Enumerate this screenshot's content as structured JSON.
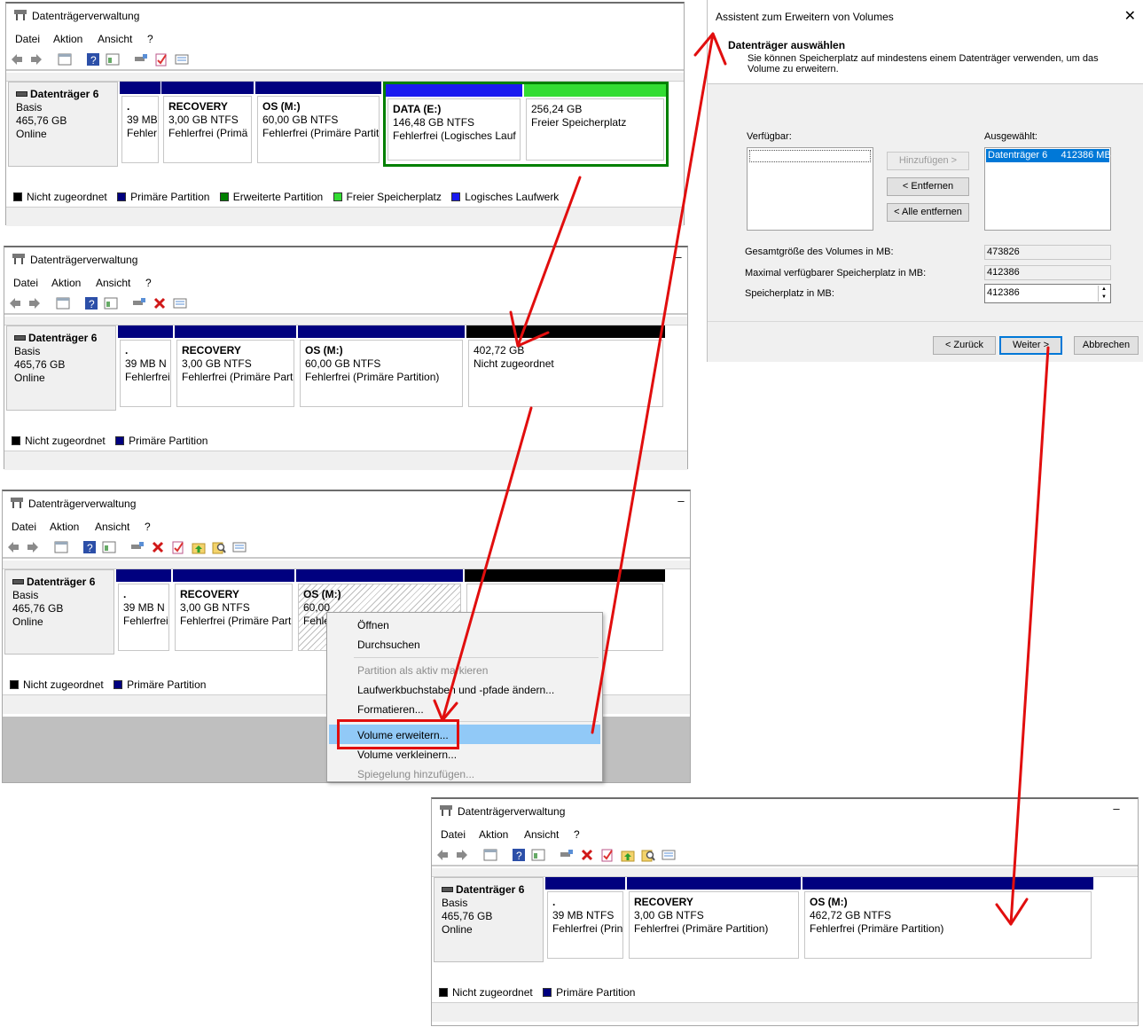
{
  "app_title": "Datenträgerverwaltung",
  "menu": {
    "file": "Datei",
    "action": "Aktion",
    "view": "Ansicht",
    "help": "?"
  },
  "disk": {
    "name": "Datenträger 6",
    "type": "Basis",
    "size": "465,76 GB",
    "status": "Online"
  },
  "panel1": {
    "partitions": [
      {
        "name": ".",
        "size": "39 MB",
        "status": "Fehler"
      },
      {
        "name": "RECOVERY",
        "size": "3,00 GB NTFS",
        "status": "Fehlerfrei (Primä"
      },
      {
        "name": "OS  (M:)",
        "size": "60,00 GB NTFS",
        "status": "Fehlerfrei (Primäre Partit"
      },
      {
        "name": "DATA  (E:)",
        "size": "146,48 GB NTFS",
        "status": "Fehlerfrei (Logisches Lauf"
      },
      {
        "name": "",
        "size": "256,24 GB",
        "status": "Freier Speicherplatz"
      }
    ],
    "legend": [
      "Nicht zugeordnet",
      "Primäre Partition",
      "Erweiterte Partition",
      "Freier Speicherplatz",
      "Logisches Laufwerk"
    ]
  },
  "panel2": {
    "partitions": [
      {
        "name": ".",
        "size": "39 MB N",
        "status": "Fehlerfrei"
      },
      {
        "name": "RECOVERY",
        "size": "3,00 GB NTFS",
        "status": "Fehlerfrei (Primäre Parti"
      },
      {
        "name": "OS  (M:)",
        "size": "60,00 GB NTFS",
        "status": "Fehlerfrei (Primäre Partition)"
      },
      {
        "name": "",
        "size": "402,72 GB",
        "status": "Nicht zugeordnet"
      }
    ],
    "legend": [
      "Nicht zugeordnet",
      "Primäre Partition"
    ]
  },
  "panel3": {
    "partitions": [
      {
        "name": ".",
        "size": "39 MB N",
        "status": "Fehlerfrei"
      },
      {
        "name": "RECOVERY",
        "size": "3,00 GB NTFS",
        "status": "Fehlerfrei (Primäre Parti"
      },
      {
        "name": "OS  (M:)",
        "size": "60,00",
        "status": "Fehle"
      },
      {
        "name": "",
        "size": "",
        "status": ""
      }
    ],
    "legend": [
      "Nicht zugeordnet",
      "Primäre Partition"
    ],
    "context_menu": {
      "open": "Öffnen",
      "explore": "Durchsuchen",
      "mark_active": "Partition als aktiv markieren",
      "change_letter": "Laufwerkbuchstaben und -pfade ändern...",
      "format": "Formatieren...",
      "extend": "Volume erweitern...",
      "shrink": "Volume verkleinern...",
      "mirror": "Spiegelung hinzufügen..."
    }
  },
  "panel4": {
    "partitions": [
      {
        "name": ".",
        "size": "39 MB NTFS",
        "status": "Fehlerfrei (Prin"
      },
      {
        "name": "RECOVERY",
        "size": "3,00 GB NTFS",
        "status": "Fehlerfrei (Primäre Partition)"
      },
      {
        "name": "OS  (M:)",
        "size": "462,72 GB NTFS",
        "status": "Fehlerfrei (Primäre Partition)"
      }
    ],
    "legend": [
      "Nicht zugeordnet",
      "Primäre Partition"
    ]
  },
  "wizard": {
    "title": "Assistent zum Erweitern von Volumes",
    "heading": "Datenträger auswählen",
    "description": "Sie können Speicherplatz auf mindestens einem Datenträger verwenden, um das Volume zu erweitern.",
    "available_label": "Verfügbar:",
    "selected_label": "Ausgewählt:",
    "selected_item": "Datenträger 6     412386 MB",
    "add_button": "Hinzufügen >",
    "remove_button": "< Entfernen",
    "remove_all_button": "< Alle entfernen",
    "total_size_label": "Gesamtgröße des Volumes in MB:",
    "total_size_value": "473826",
    "max_space_label": "Maximal verfügbarer Speicherplatz in MB:",
    "max_space_value": "412386",
    "space_label": "Speicherplatz in MB:",
    "space_value": "412386",
    "back_button": "< Zurück",
    "next_button": "Weiter >",
    "cancel_button": "Abbrechen"
  },
  "colors": {
    "unallocated": "#000000",
    "primary": "#00007f",
    "extended": "#008000",
    "free": "#33dd33",
    "logical": "#1a1af0",
    "arrow": "#e10e0e",
    "menu_highlight": "#91c9f7"
  }
}
